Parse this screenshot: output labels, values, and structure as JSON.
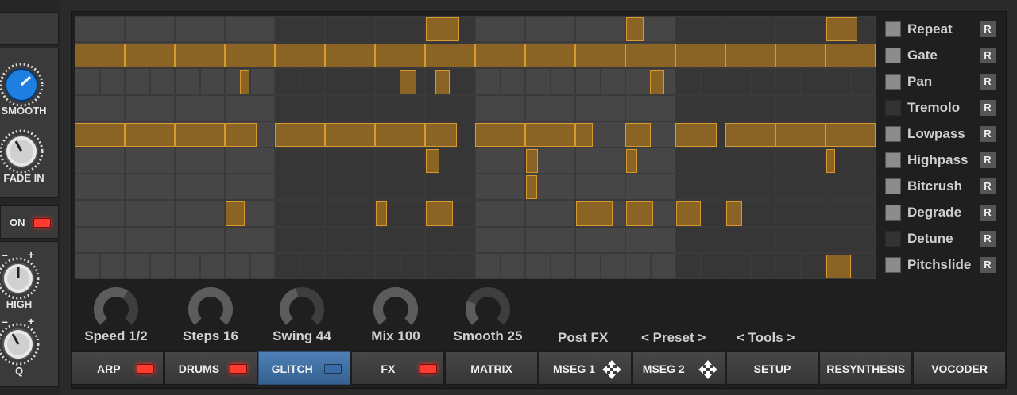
{
  "left_panel": {
    "knob1_label": "SMOOTH",
    "knob2_label": "FADE IN",
    "on_label": "ON",
    "knob3_label": "HIGH",
    "knob4_label": "Q",
    "minus": "–",
    "plus": "+"
  },
  "lanes": [
    {
      "label": "Repeat",
      "enabled": true,
      "r": "R"
    },
    {
      "label": "Gate",
      "enabled": true,
      "r": "R"
    },
    {
      "label": "Pan",
      "enabled": true,
      "r": "R"
    },
    {
      "label": "Tremolo",
      "enabled": false,
      "r": "R"
    },
    {
      "label": "Lowpass",
      "enabled": true,
      "r": "R"
    },
    {
      "label": "Highpass",
      "enabled": true,
      "r": "R"
    },
    {
      "label": "Bitcrush",
      "enabled": true,
      "r": "R"
    },
    {
      "label": "Degrade",
      "enabled": true,
      "r": "R"
    },
    {
      "label": "Detune",
      "enabled": false,
      "r": "R"
    },
    {
      "label": "Pitchslide",
      "enabled": true,
      "r": "R"
    }
  ],
  "params": [
    {
      "label": "Speed 1/2",
      "value": 0.62
    },
    {
      "label": "Steps 16",
      "value": 1.0
    },
    {
      "label": "Swing 44",
      "value": 0.44
    },
    {
      "label": "Mix 100",
      "value": 1.0
    },
    {
      "label": "Smooth 25",
      "value": 0.25
    }
  ],
  "selectors": {
    "post_fx": "Post FX",
    "preset": "< Preset >",
    "tools": "< Tools >"
  },
  "tabs": [
    {
      "label": "ARP",
      "led": "red"
    },
    {
      "label": "DRUMS",
      "led": "red"
    },
    {
      "label": "GLITCH",
      "led": "blue",
      "active": true
    },
    {
      "label": "FX",
      "led": "red"
    },
    {
      "label": "MATRIX"
    },
    {
      "label": "MSEG 1",
      "icon": "move-icon"
    },
    {
      "label": "MSEG 2",
      "icon": "move-icon"
    },
    {
      "label": "SETUP"
    },
    {
      "label": "RESYNTHESIS"
    },
    {
      "label": "VOCODER"
    }
  ],
  "colors": {
    "accent_orange": "#d89a30",
    "active_tab": "#4e7fb6",
    "knob_blue": "#1f7fe0",
    "led_red": "#ff3a2e"
  }
}
